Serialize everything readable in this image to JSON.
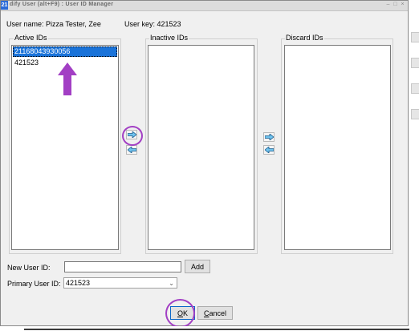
{
  "window": {
    "title": "dify User (alt+F9) : User ID Manager",
    "app_icon_text": "21",
    "controls": {
      "minimize": "–",
      "maximize": "□",
      "close": "×"
    }
  },
  "user": {
    "name_label": "User name:",
    "name_value": "Pizza Tester, Zee",
    "key_label": "User key:",
    "key_value": "421523"
  },
  "groups": {
    "active": {
      "label": "Active IDs",
      "items": [
        {
          "text": "21168043930056",
          "selected": true
        },
        {
          "text": "421523",
          "selected": false
        }
      ]
    },
    "inactive": {
      "label": "Inactive IDs",
      "items": []
    },
    "discard": {
      "label": "Discard IDs",
      "items": []
    }
  },
  "arrows": {
    "move_right_icon": "arrow-right-icon",
    "move_left_icon": "arrow-left-icon"
  },
  "form": {
    "new_user_id_label": "New User ID:",
    "new_user_id_value": "",
    "add_button": "Add",
    "primary_user_id_label": "Primary User ID:",
    "primary_user_id_value": "421523"
  },
  "buttons": {
    "ok_mnemonic": "O",
    "ok_rest": "K",
    "cancel_mnemonic": "C",
    "cancel_rest": "ancel"
  },
  "colors": {
    "selection": "#1a73d9",
    "annotation": "#a23fc4",
    "arrow_fill": "#6fc3ee"
  }
}
